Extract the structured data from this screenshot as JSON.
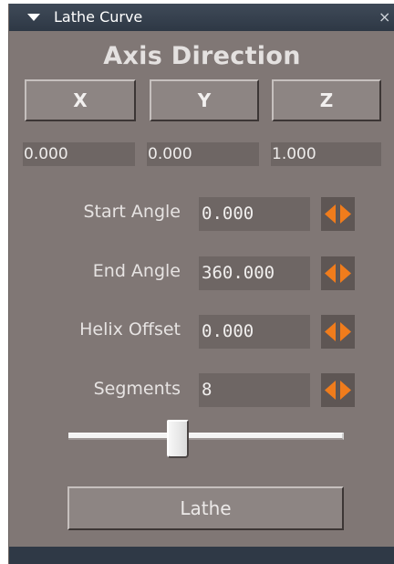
{
  "panel": {
    "title": "Lathe Curve",
    "collapse_icon": "triangle-down-icon",
    "close_icon": "close-icon",
    "close_glyph": "×"
  },
  "axis": {
    "heading": "Axis Direction",
    "buttons": [
      {
        "label": "X"
      },
      {
        "label": "Y"
      },
      {
        "label": "Z"
      }
    ],
    "values": [
      "0.000",
      "0.000",
      "1.000"
    ]
  },
  "params": [
    {
      "label": "Start Angle",
      "value": "0.000",
      "spinner_icon": "left-right-arrows-icon"
    },
    {
      "label": "End Angle",
      "value": "360.000",
      "spinner_icon": "left-right-arrows-icon"
    },
    {
      "label": "Helix Offset",
      "value": "0.000",
      "spinner_icon": "left-right-arrows-icon"
    },
    {
      "label": "Segments",
      "value": "8",
      "spinner_icon": "left-right-arrows-icon"
    }
  ],
  "slider": {
    "position_fraction": 0.4
  },
  "action": {
    "label": "Lathe"
  },
  "colors": {
    "panel_bg": "#807775",
    "titlebar": "#2e3845",
    "field_bg": "#6e6664",
    "spinner_arrow": "#f07c1c"
  }
}
